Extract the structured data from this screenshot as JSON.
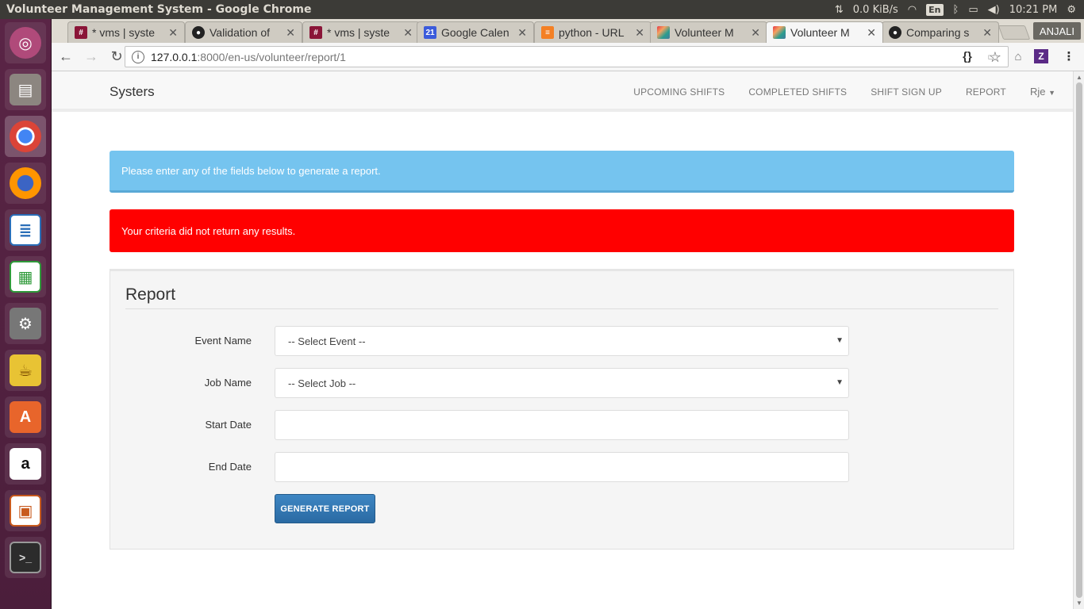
{
  "os": {
    "window_title": "Volunteer Management System - Google Chrome",
    "network_speed": "0.0 KiB/s",
    "keyboard_lang": "En",
    "clock": "10:21 PM"
  },
  "browser": {
    "profile_name": "ANJALI",
    "url_host": "127.0.0.1",
    "url_path": ":8000/en-us/volunteer/report/1",
    "tabs": [
      {
        "label": "* vms | syste",
        "icon": "slack-icon",
        "color": "#8a1538"
      },
      {
        "label": "Validation of",
        "icon": "github-icon",
        "color": "#222222"
      },
      {
        "label": "* vms | syste",
        "icon": "slack-icon",
        "color": "#8a1538"
      },
      {
        "label": "Google Calen",
        "icon": "calendar-icon",
        "color": "#3b5bdb"
      },
      {
        "label": "python - URL",
        "icon": "stackoverflow-icon",
        "color": "#f48024"
      },
      {
        "label": "Volunteer M",
        "icon": "systers-icon",
        "color": "#7fbf3f"
      },
      {
        "label": "Volunteer M",
        "icon": "systers-icon",
        "color": "#7fbf3f"
      },
      {
        "label": "Comparing s",
        "icon": "github-icon",
        "color": "#222222"
      }
    ],
    "calendar_badge": "21"
  },
  "site": {
    "brand": "Systers",
    "nav": {
      "upcoming": "UPCOMING SHIFTS",
      "completed": "COMPLETED SHIFTS",
      "signup": "SHIFT SIGN UP",
      "report": "REPORT",
      "user": "Rje"
    },
    "info_alert": "Please enter any of the fields below to generate a report.",
    "error_alert": "Your criteria did not return any results.",
    "report": {
      "title": "Report",
      "event_label": "Event Name",
      "event_value": "-- Select Event --",
      "job_label": "Job Name",
      "job_value": "-- Select Job --",
      "start_label": "Start Date",
      "start_value": "",
      "end_label": "End Date",
      "end_value": "",
      "submit": "GENERATE REPORT"
    }
  },
  "colors": {
    "info": "#75c4ef",
    "danger": "#ff0000",
    "primary": "#337ab7",
    "launcher": "#5a2546"
  }
}
